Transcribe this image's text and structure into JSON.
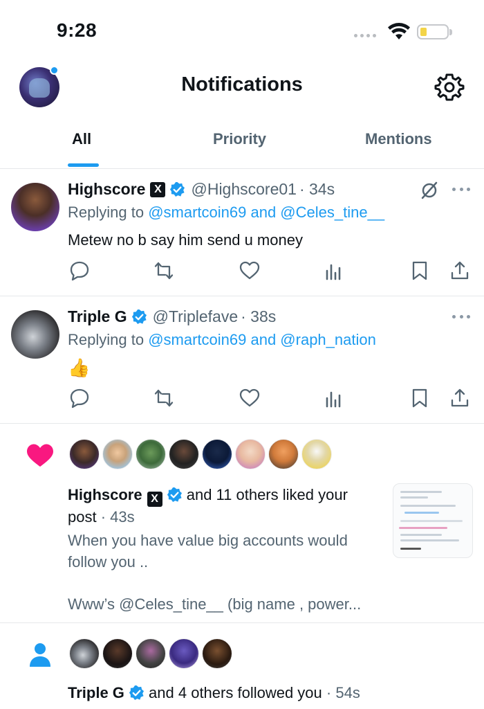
{
  "status": {
    "time": "9:28"
  },
  "header": {
    "title": "Notifications"
  },
  "tabs": [
    {
      "label": "All",
      "active": true
    },
    {
      "label": "Priority",
      "active": false
    },
    {
      "label": "Mentions",
      "active": false
    }
  ],
  "tweets": [
    {
      "name": "Highscore",
      "affiliate_badge": "X",
      "verified": true,
      "handle": "@Highscore01",
      "time": "· 34s",
      "reply_prefix": "Replying to",
      "reply_to": "@smartcoin69 and @Celes_tine__",
      "text": "Metew no b say him send u money"
    },
    {
      "name": "Triple G",
      "verified": true,
      "handle": "@Triplefave",
      "time": "· 38s",
      "reply_prefix": "Replying to",
      "reply_to": "@smartcoin69 and @raph_nation",
      "text": "👍"
    }
  ],
  "like_notification": {
    "icon": "heart-icon",
    "name": "Highscore",
    "affiliate_badge": "X",
    "text": "and 11 others liked your",
    "text2": "post",
    "time": "· 43s",
    "preview_line1": "When you have value big accounts would",
    "preview_line2": "follow you ..",
    "preview_line3": "Www’s @Celes_tine__ (big name , power..."
  },
  "follow_notification": {
    "icon": "person-icon",
    "name": "Triple G",
    "text": "and 4 others followed you",
    "time": "· 54s"
  },
  "colors": {
    "accent": "#1d9bf0",
    "like": "#f91880",
    "text": "#0f1419",
    "muted": "#536471"
  }
}
